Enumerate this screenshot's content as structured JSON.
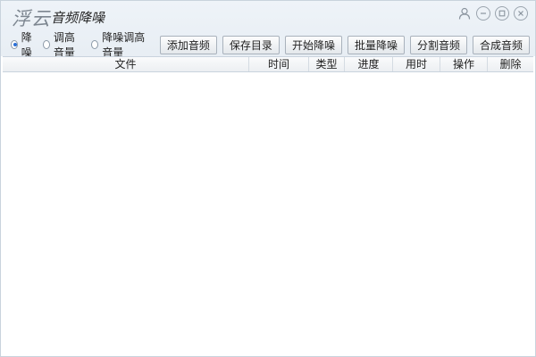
{
  "app": {
    "logo": "浮云",
    "title": "音频降噪"
  },
  "window_controls": [
    "user-icon",
    "minimize-icon",
    "maximize-icon",
    "close-icon"
  ],
  "modes": [
    {
      "label": "降噪",
      "checked": true
    },
    {
      "label": "调高音量",
      "checked": false
    },
    {
      "label": "降噪调高音量",
      "checked": false
    }
  ],
  "toolbar": {
    "add_label": "添加音频",
    "save_dir_label": "保存目录",
    "start_label": "开始降噪",
    "batch_label": "批量降噪",
    "split_label": "分割音频",
    "merge_label": "合成音频"
  },
  "table": {
    "columns": [
      "文件",
      "时间",
      "类型",
      "进度",
      "用时",
      "操作",
      "删除"
    ],
    "rows": []
  },
  "colors": {
    "header_bg": "#e8eef4",
    "border": "#c9d3dd",
    "radio_accent": "#2a6fd6"
  }
}
